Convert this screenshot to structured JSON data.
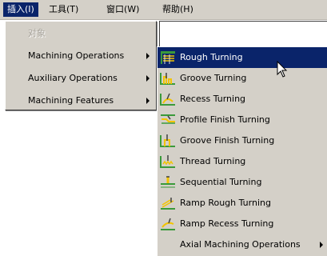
{
  "menubar": {
    "items": [
      {
        "label": "插入(I)",
        "active": true
      },
      {
        "label": "工具(T)",
        "active": false
      },
      {
        "label": "窗口(W)",
        "active": false
      },
      {
        "label": "帮助(H)",
        "active": false
      }
    ]
  },
  "insert_menu": {
    "items": [
      {
        "label": "对象",
        "enabled": false
      },
      {
        "label": "Machining Operations",
        "submenu": true
      },
      {
        "label": "Auxiliary Operations",
        "submenu": true
      },
      {
        "label": "Machining Features",
        "submenu": true
      }
    ]
  },
  "machining_submenu": {
    "items": [
      {
        "label": "Rough Turning",
        "icon": "rough-turning-icon",
        "selected": true
      },
      {
        "label": "Groove Turning",
        "icon": "groove-turning-icon"
      },
      {
        "label": "Recess Turning",
        "icon": "recess-turning-icon"
      },
      {
        "label": "Profile Finish Turning",
        "icon": "profile-finish-turning-icon"
      },
      {
        "label": "Groove Finish Turning",
        "icon": "groove-finish-turning-icon"
      },
      {
        "label": "Thread Turning",
        "icon": "thread-turning-icon"
      },
      {
        "label": "Sequential Turning",
        "icon": "sequential-turning-icon"
      },
      {
        "label": "Ramp Rough Turning",
        "icon": "ramp-rough-turning-icon"
      },
      {
        "label": "Ramp Recess Turning",
        "icon": "ramp-recess-turning-icon"
      },
      {
        "label": "Axial Machining Operations",
        "submenu": true
      }
    ]
  },
  "colors": {
    "menu_bg": "#d4d0c8",
    "highlight": "#0a246a",
    "icon_yellow": "#f2c400",
    "icon_green": "#3a9a3a"
  }
}
